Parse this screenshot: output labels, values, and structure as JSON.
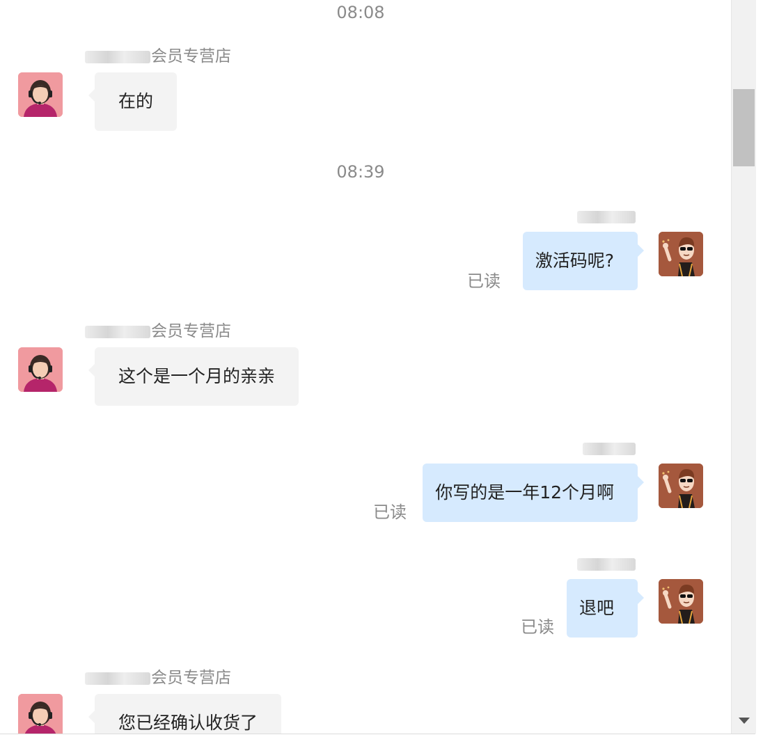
{
  "messages": [
    {
      "type": "time",
      "text": "08:08"
    },
    {
      "type": "msg",
      "side": "left",
      "sender_suffix": "会员专营店",
      "text": "在的"
    },
    {
      "type": "time",
      "text": "08:39"
    },
    {
      "type": "msg",
      "side": "right",
      "text": "激活码呢?",
      "status": "已读"
    },
    {
      "type": "msg",
      "side": "left",
      "sender_suffix": "会员专营店",
      "text": "这个是一个月的亲亲"
    },
    {
      "type": "msg",
      "side": "right",
      "text": "你写的是一年12个月啊",
      "status": "已读"
    },
    {
      "type": "msg",
      "side": "right",
      "text": "退吧",
      "status": "已读"
    },
    {
      "type": "msg",
      "side": "left",
      "sender_suffix": "会员专营店",
      "text": "您已经确认收货了"
    }
  ],
  "icons": {
    "agent_avatar": "customer-service-headset-avatar",
    "user_avatar": "cartoon-man-sunglasses-avatar",
    "scroll_down": "triangle-down-icon"
  },
  "colors": {
    "left_bubble": "#f3f3f3",
    "right_bubble": "#d6eafe",
    "meta_text": "#8a8a8a"
  }
}
